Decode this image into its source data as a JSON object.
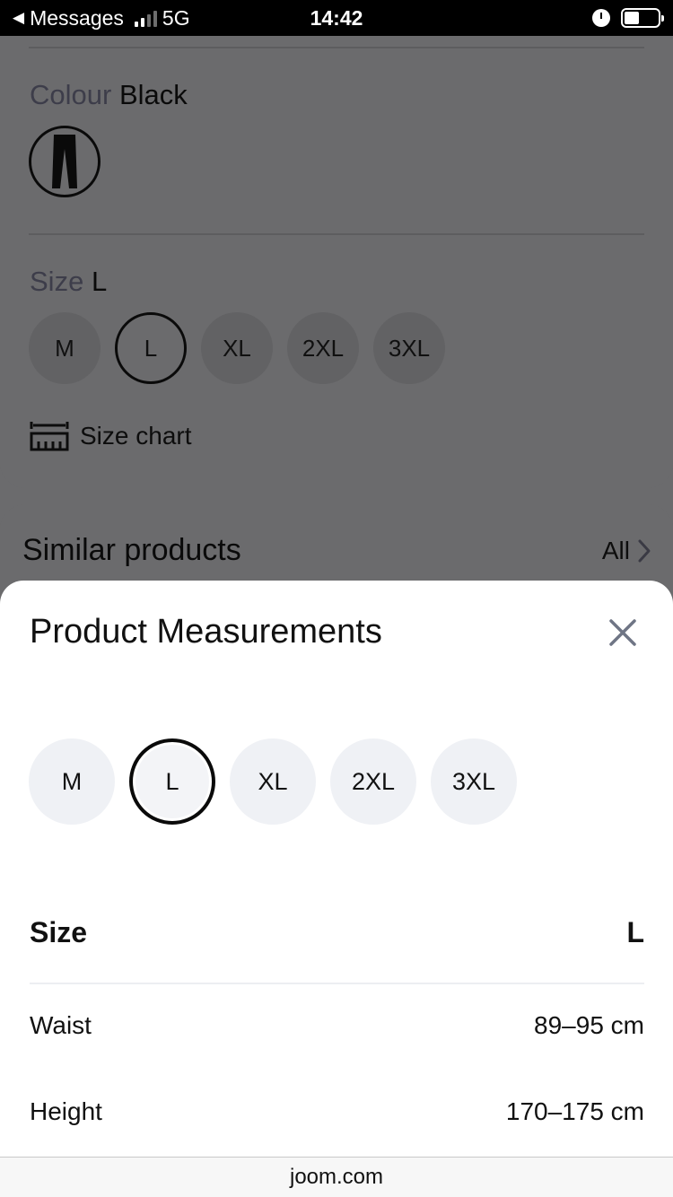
{
  "status_bar": {
    "back_label": "Messages",
    "network": "5G",
    "time": "14:42"
  },
  "product": {
    "colour_label": "Colour",
    "colour_value": "Black",
    "size_label": "Size",
    "size_value": "L",
    "sizes": [
      "M",
      "L",
      "XL",
      "2XL",
      "3XL"
    ],
    "size_chart_label": "Size chart"
  },
  "similar": {
    "title": "Similar products",
    "all_label": "All"
  },
  "sheet": {
    "title": "Product Measurements",
    "sizes": [
      "M",
      "L",
      "XL",
      "2XL",
      "3XL"
    ],
    "selected_size": "L",
    "table_header": {
      "label": "Size",
      "value": "L"
    },
    "rows": [
      {
        "label": "Waist",
        "value": "89–95 cm"
      },
      {
        "label": "Height",
        "value": "170–175 cm"
      }
    ]
  },
  "browser": {
    "url": "joom.com"
  },
  "colors": {
    "overlay_bg": "#6b6b6d",
    "chip_bg": "#eff1f5",
    "sheet_bg": "#ffffff"
  }
}
